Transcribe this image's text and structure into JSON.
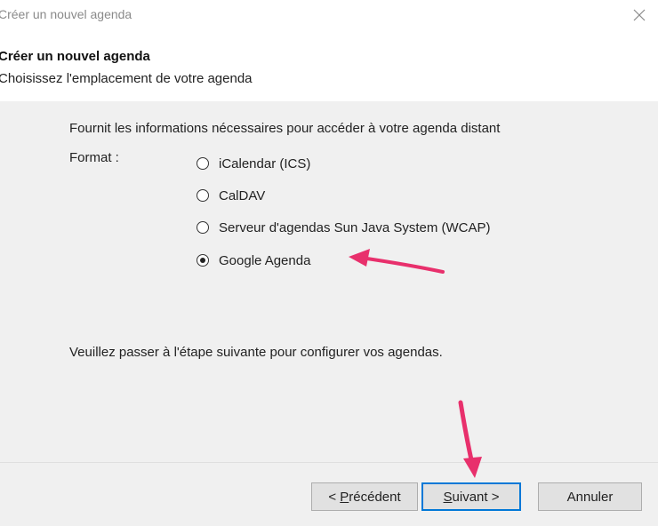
{
  "window": {
    "title": "Créer un nouvel agenda",
    "close_icon": "close-icon"
  },
  "header": {
    "title": "Créer un nouvel agenda",
    "subtitle": "Choisissez l'emplacement de votre agenda"
  },
  "content": {
    "intro": "Fournit les informations nécessaires pour accéder à votre agenda distant",
    "format_label": "Format :",
    "format_options": [
      {
        "label": "iCalendar (ICS)",
        "selected": false
      },
      {
        "label": "CalDAV",
        "selected": false
      },
      {
        "label": "Serveur d'agendas Sun Java System (WCAP)",
        "selected": false
      },
      {
        "label": "Google Agenda",
        "selected": true
      }
    ],
    "hint": "Veuillez passer à l'étape suivante pour configurer vos agendas."
  },
  "footer": {
    "prev_prefix": "< ",
    "prev_mnemonic": "P",
    "prev_rest": "récédent",
    "next_mnemonic": "S",
    "next_rest": "uivant >",
    "cancel_label": "Annuler"
  },
  "annotations": {
    "arrow_color": "#e8306c"
  }
}
